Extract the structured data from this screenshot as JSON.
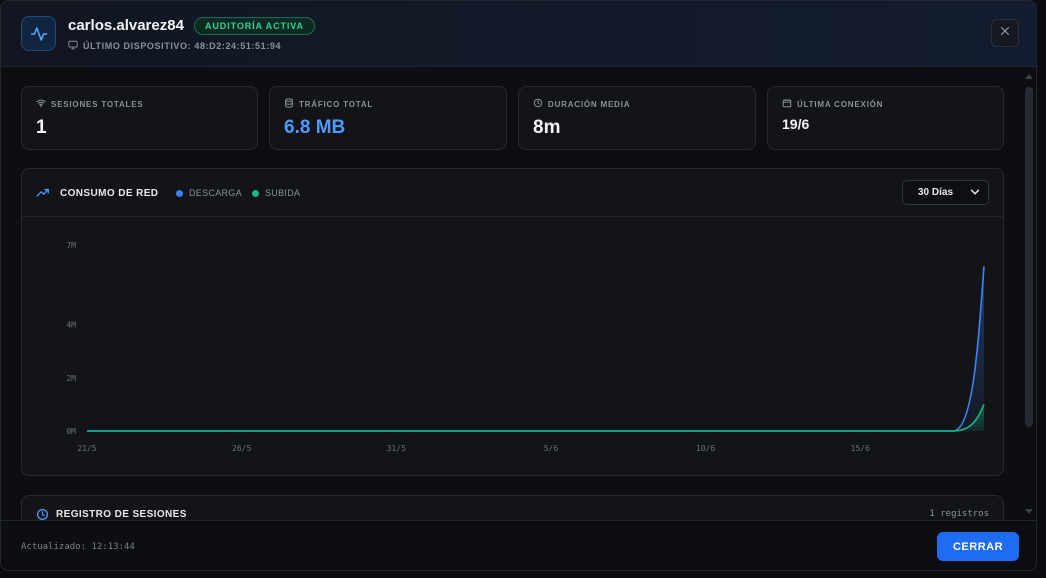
{
  "header": {
    "username": "carlos.alvarez84",
    "badge": "AUDITORÍA ACTIVA",
    "device_label": "ÚLTIMO DISPOSITIVO: 48:D2:24:51:51:94"
  },
  "stats": [
    {
      "label": "SESIONES TOTALES",
      "value": "1",
      "icon": "wifi-icon"
    },
    {
      "label": "TRÁFICO TOTAL",
      "value": "6.8 MB",
      "icon": "database-icon"
    },
    {
      "label": "DURACIÓN MEDIA",
      "value": "8m",
      "icon": "clock-icon"
    },
    {
      "label": "ÚLTIMA CONEXIÓN",
      "value": "19/6",
      "icon": "calendar-icon"
    }
  ],
  "chart_panel": {
    "title": "CONSUMO DE RED",
    "range_value": "30 Días"
  },
  "chart_data": {
    "type": "area",
    "title": "CONSUMO DE RED",
    "ylabel": "",
    "xlabel": "",
    "y_ticks": [
      "0M",
      "2M",
      "4M",
      "7M"
    ],
    "y_tick_values": [
      0,
      2,
      4,
      7
    ],
    "ylim": [
      0,
      7
    ],
    "x_ticks": [
      "21/5",
      "26/5",
      "31/5",
      "5/6",
      "10/6",
      "15/6"
    ],
    "x_days": [
      "21/5",
      "22/5",
      "23/5",
      "24/5",
      "25/5",
      "26/5",
      "27/5",
      "28/5",
      "29/5",
      "30/5",
      "31/5",
      "1/6",
      "2/6",
      "3/6",
      "4/6",
      "5/6",
      "6/6",
      "7/6",
      "8/6",
      "9/6",
      "10/6",
      "11/6",
      "12/6",
      "13/6",
      "14/6",
      "15/6",
      "16/6",
      "17/6",
      "18/6",
      "19/6"
    ],
    "series": [
      {
        "name": "DESCARGA",
        "color": "#3b82f6",
        "values": [
          0,
          0,
          0,
          0,
          0,
          0,
          0,
          0,
          0,
          0,
          0,
          0,
          0,
          0,
          0,
          0,
          0,
          0,
          0,
          0,
          0,
          0,
          0,
          0,
          0,
          0,
          0,
          0,
          0,
          6.2
        ]
      },
      {
        "name": "SUBIDA",
        "color": "#10b981",
        "values": [
          0,
          0,
          0,
          0,
          0,
          0,
          0,
          0,
          0,
          0,
          0,
          0,
          0,
          0,
          0,
          0,
          0,
          0,
          0,
          0,
          0,
          0,
          0,
          0,
          0,
          0,
          0,
          0,
          0,
          1.0
        ]
      }
    ],
    "grid": false,
    "legend": "top-left"
  },
  "sessions": {
    "title": "REGISTRO DE SESIONES",
    "count": "1 registros"
  },
  "footer": {
    "updated": "Actualizado: 12:13:44",
    "close_label": "CERRAR"
  },
  "colors": {
    "accent": "#1f6bf2",
    "download": "#3b82f6",
    "upload": "#10b981",
    "badge": "#34d399"
  }
}
